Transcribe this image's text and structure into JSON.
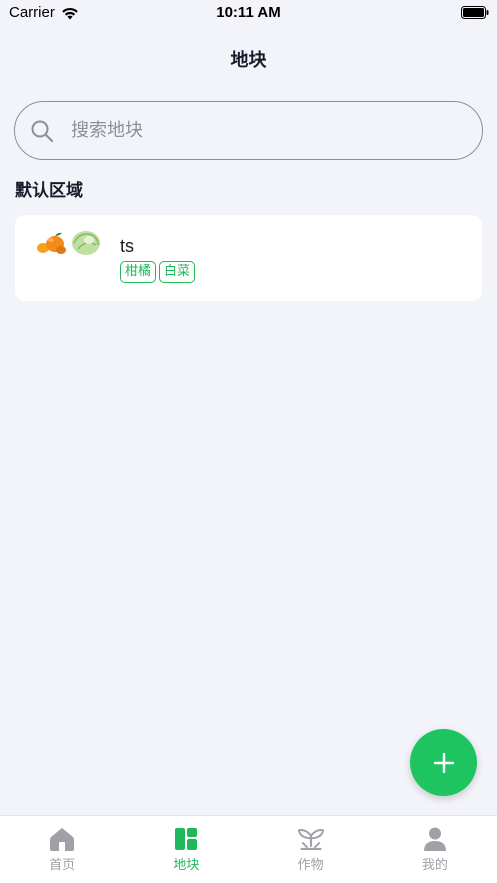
{
  "status_bar": {
    "carrier": "Carrier",
    "time": "10:11 AM"
  },
  "nav": {
    "title": "地块"
  },
  "search": {
    "placeholder": "搜索地块",
    "value": ""
  },
  "section": {
    "title": "默认区域"
  },
  "plots": [
    {
      "name": "ts",
      "crop_icons": [
        "orange-icon",
        "cabbage-icon"
      ],
      "tags": [
        "柑橘",
        "白菜"
      ]
    }
  ],
  "fab": {
    "icon": "plus-icon"
  },
  "tabs": [
    {
      "label": "首页",
      "icon": "home-icon",
      "active": false
    },
    {
      "label": "地块",
      "icon": "plots-icon",
      "active": true
    },
    {
      "label": "作物",
      "icon": "crops-icon",
      "active": false
    },
    {
      "label": "我的",
      "icon": "user-icon",
      "active": false
    }
  ],
  "colors": {
    "accent": "#1fb85a",
    "fab": "#1ec45f",
    "background": "#f3f4fa",
    "inactive_tab": "#a0a0a6"
  }
}
